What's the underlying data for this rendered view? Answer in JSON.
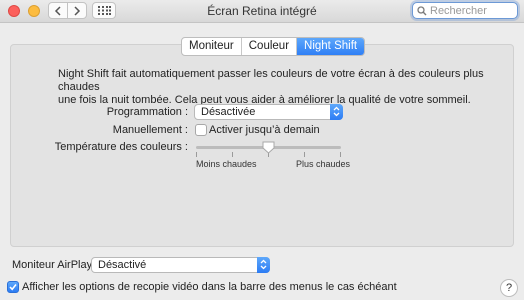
{
  "window": {
    "title": "Écran Retina intégré",
    "search_placeholder": "Rechercher"
  },
  "tabs": [
    {
      "label": "Moniteur",
      "active": false
    },
    {
      "label": "Couleur",
      "active": false
    },
    {
      "label": "Night Shift",
      "active": true
    }
  ],
  "night_shift": {
    "description_line1": "Night Shift fait automatiquement passer les couleurs de votre écran à des couleurs plus chaudes",
    "description_line2": "une fois la nuit tombée. Cela peut vous aider à améliorer la qualité de votre sommeil.",
    "schedule_label": "Programmation :",
    "schedule_value": "Désactivée",
    "manual_label": "Manuellement :",
    "manual_checkbox_label": "Activer jusqu’à demain",
    "manual_checked": false,
    "temperature_label": "Température des couleurs :",
    "temperature_min_label": "Moins chaudes",
    "temperature_max_label": "Plus chaudes",
    "temperature_level": 0.5
  },
  "airplay": {
    "label": "Moniteur AirPlay :",
    "value": "Désactivé"
  },
  "mirroring": {
    "label": "Afficher les options de recopie vidéo dans la barre des menus le cas échéant",
    "checked": true
  },
  "help_label": "?",
  "colors": {
    "accent": "#2f7ff5"
  },
  "icons": {
    "back": "chevron-left-icon",
    "forward": "chevron-right-icon",
    "grid": "grid-icon",
    "search": "search-icon",
    "popup": "updown-chevron-icon",
    "check": "checkmark-icon"
  }
}
